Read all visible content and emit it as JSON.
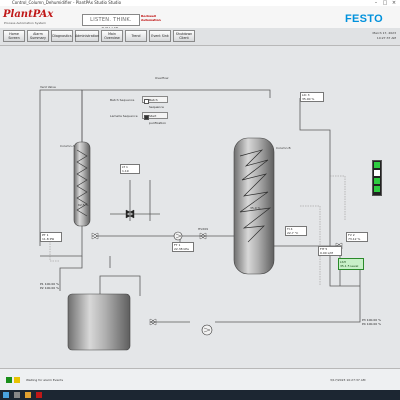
{
  "window": {
    "title": "Control_Column_Dehumidifier - PlantPAx Studio Studio"
  },
  "header": {
    "logo": "PlantPAx",
    "logo_sub": "Process Automation System",
    "slogan": "LISTEN. THINK. SOLVE.",
    "brand_badge": "Rockwell Automation",
    "festo": "FESTO"
  },
  "menu": {
    "items": [
      "Home Screen",
      "Alarm Summary",
      "Diagnostics",
      "Administration",
      "Main Overview",
      "Trend",
      "Event Sink",
      "Shutdown Client"
    ],
    "date": "March 17, 2023",
    "time": "10:27:37 AM"
  },
  "diagram": {
    "labels": {
      "overflow": "Overflow",
      "column_a": "Column A",
      "column_b": "Column B",
      "column_a_level": "62.5 %",
      "column_b_level": "35.0 %",
      "column_a_full_label": "Column A",
      "column_b_full_label": "Column B",
      "top_line_left": "Vent Valve",
      "valve_main": "HV209"
    },
    "sequence_panel": {
      "batch_label": "Batch Sequence",
      "batch_button": "Batch Sequence",
      "lamella_label": "Lamella Sequence",
      "lamella_button": "Start purification"
    },
    "boxes": [
      {
        "id": "lt1",
        "text": "LT 1"
      },
      {
        "id": "lt2",
        "text": "1.19"
      },
      {
        "id": "pt1",
        "text": "PT 1"
      },
      {
        "id": "pt1v",
        "text": "11.8 PSI"
      },
      {
        "id": "t1",
        "text": "FT 1"
      },
      {
        "id": "t1v",
        "text": "22.38 kPa"
      },
      {
        "id": "lt3",
        "text": "LIC 3"
      },
      {
        "id": "lt3v",
        "text": "35.00 %"
      },
      {
        "id": "ti4",
        "text": "TI 4"
      },
      {
        "id": "ti4v",
        "text": "22.7 °C"
      },
      {
        "id": "fit5",
        "text": "FIT 5"
      },
      {
        "id": "fit5v",
        "text": "0.00 L/M"
      },
      {
        "id": "fv2",
        "text": "FV 2"
      },
      {
        "id": "fv2v",
        "text": "73.12 %"
      }
    ],
    "status_green": {
      "line1": "LSH",
      "line2": "35.1 F-Level"
    },
    "pump_params": [
      "P1",
      "P2",
      "P3",
      "P4"
    ],
    "pump_values": [
      "100.00 %",
      "100.00 %",
      "100.00 %",
      "100.00 %"
    ]
  },
  "status": {
    "message": "Waiting for alarm Events",
    "footer": "3/17/2023 10:27:37 AM"
  },
  "colors": {
    "festo_blue": "#0091dc",
    "pipe": "#555555",
    "vessel": "#9a9a9a",
    "green_ok": "#2ecc40",
    "brand_red": "#c01818"
  }
}
